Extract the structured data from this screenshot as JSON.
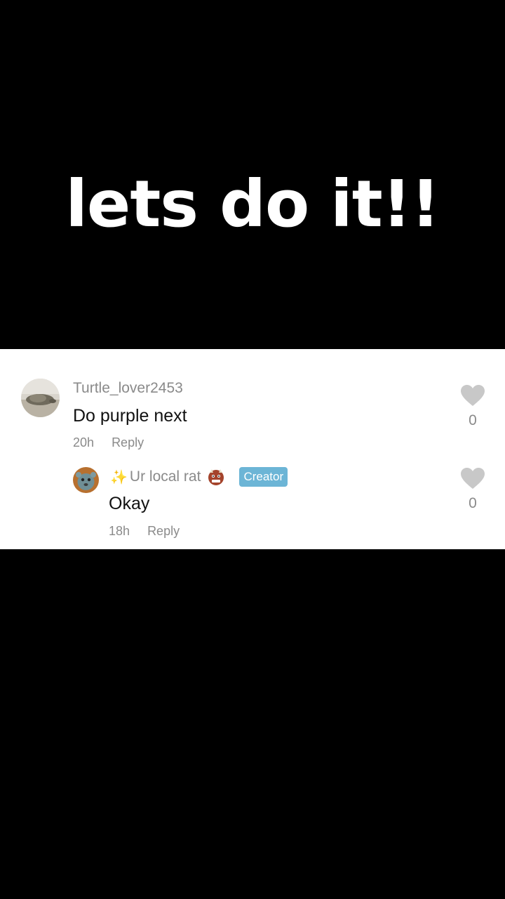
{
  "video": {
    "caption": "lets do it!!"
  },
  "comment": {
    "username": "Turtle_lover2453",
    "text": "Do purple next",
    "time": "20h",
    "reply_label": "Reply",
    "likes": "0"
  },
  "reply": {
    "username_prefix": "✨",
    "username": "Ur local rat",
    "badge": "Creator",
    "text": "Okay",
    "time": "18h",
    "reply_label": "Reply",
    "likes": "0"
  },
  "colors": {
    "background": "#000000",
    "card": "#ffffff",
    "muted_text": "#8a8a8a",
    "creator_badge": "#6cb5d6",
    "heart": "#c8c8c8"
  },
  "icons": {
    "like": "heart-icon",
    "reply_user_emoji": "ogre-face-icon"
  }
}
